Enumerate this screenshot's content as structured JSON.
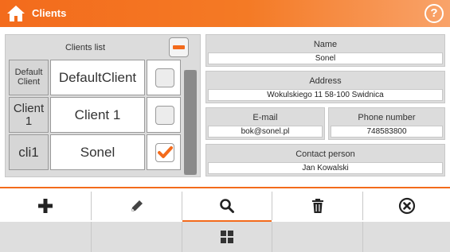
{
  "header": {
    "title": "Clients",
    "help_label": "?"
  },
  "clients_list": {
    "title": "Clients list",
    "rows": [
      {
        "id": "Default Client",
        "name": "DefaultClient",
        "checked": false
      },
      {
        "id": "Client 1",
        "name": "Client 1",
        "checked": false
      },
      {
        "id": "cli1",
        "name": "Sonel",
        "checked": true
      }
    ]
  },
  "details": {
    "name_label": "Name",
    "name_value": "Sonel",
    "address_label": "Address",
    "address_value": "Wokulskiego 11 58-100 Swidnica",
    "email_label": "E-mail",
    "email_value": "bok@sonel.pl",
    "phone_label": "Phone number",
    "phone_value": "748583800",
    "contact_label": "Contact person",
    "contact_value": "Jan Kowalski"
  },
  "toolbar": {
    "buttons": [
      "add-icon",
      "edit-icon",
      "search-icon",
      "delete-icon",
      "close-icon"
    ],
    "active": "search-icon",
    "secondary": [
      "grid-icon"
    ]
  },
  "colors": {
    "accent": "#f36b1c",
    "panel": "#dcdcdc"
  }
}
